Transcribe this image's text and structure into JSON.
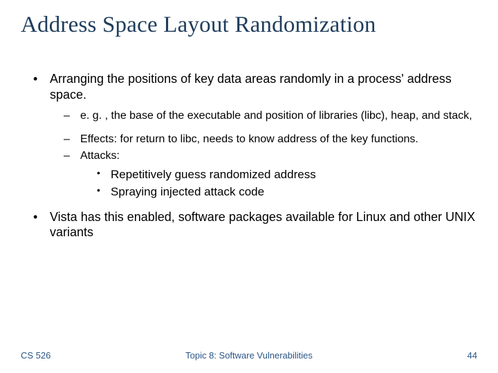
{
  "title": "Address Space Layout Randomization",
  "bullets": {
    "arranging": "Arranging the positions of key data areas randomly in a process' address space.",
    "eg": "e. g. , the base of the executable and position of libraries (libc), heap, and stack,",
    "effects": "Effects: for return to libc, needs to know address of the key functions.",
    "attacks": "Attacks:",
    "attack1": "Repetitively guess randomized address",
    "attack2": "Spraying injected attack code",
    "vista": "Vista has this enabled, software packages available for Linux and other UNIX variants"
  },
  "footer": {
    "course": "CS 526",
    "topic": "Topic 8: Software Vulnerabilities",
    "page": "44"
  }
}
